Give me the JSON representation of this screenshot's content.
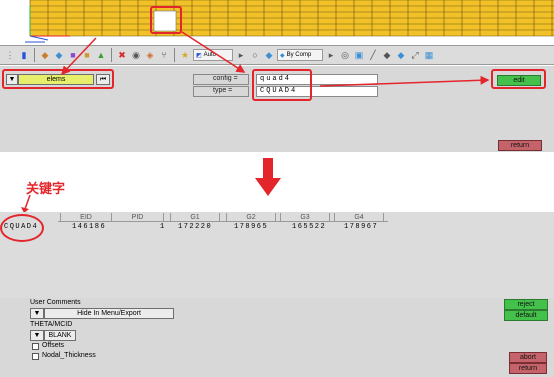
{
  "viewport": {
    "label": "3D mesh viewport",
    "mesh_color": "#f2c128"
  },
  "toolbar": {
    "auto_label": "Auto",
    "by_comp_label": "By Comp"
  },
  "panel_top": {
    "selector_label": "elems",
    "config_label": "config =",
    "config_value": "quad4",
    "type_label": "type =",
    "type_value": "CQUAD4",
    "edit_label": "edit",
    "return_label": "return"
  },
  "annotation": {
    "keyword_text": "关键字",
    "accent_color": "#e3262c"
  },
  "table": {
    "row_label": "CQUAD4",
    "headers": [
      "EID",
      "PID",
      "G1",
      "G2",
      "G3",
      "G4"
    ],
    "values": [
      "146186",
      "1",
      "172220",
      "178965",
      "165522",
      "178967"
    ]
  },
  "panel_bottom": {
    "user_comments": "User Comments",
    "hide_label": "Hide In Menu/Export",
    "theta_label": "THETA/MCID",
    "blank_label": "BLANK",
    "offsets_label": "Offsets",
    "nodal_label": "Nodal_Thickness",
    "reject_label": "reject",
    "default_label": "default",
    "abort_label": "abort",
    "return_label": "return"
  }
}
